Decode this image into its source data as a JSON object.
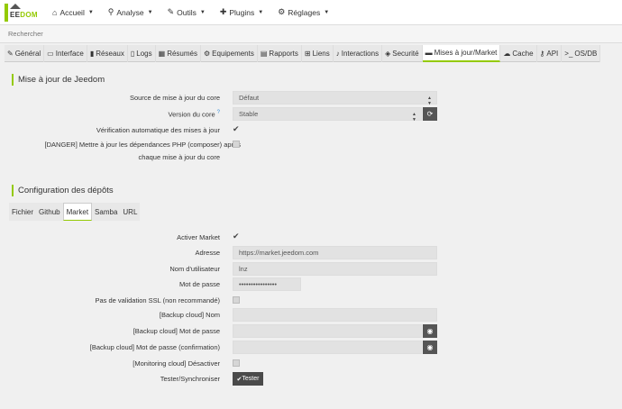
{
  "navbar": {
    "logo_text_a": "EE",
    "logo_text_b": "DOM",
    "items": [
      {
        "label": "Accueil",
        "icon": "home-icon"
      },
      {
        "label": "Analyse",
        "icon": "analysis-icon"
      },
      {
        "label": "Outils",
        "icon": "wrench-icon"
      },
      {
        "label": "Plugins",
        "icon": "puzzle-icon"
      },
      {
        "label": "Réglages",
        "icon": "gear-icon"
      }
    ]
  },
  "search": {
    "placeholder": "Rechercher"
  },
  "tabs": [
    {
      "label": "Général",
      "icon": "wrench-icon"
    },
    {
      "label": "Interface",
      "icon": "laptop-icon"
    },
    {
      "label": "Réseaux",
      "icon": "signal-icon"
    },
    {
      "label": "Logs",
      "icon": "file-icon"
    },
    {
      "label": "Résumés",
      "icon": "table-icon"
    },
    {
      "label": "Equipements",
      "icon": "cog-icon"
    },
    {
      "label": "Rapports",
      "icon": "print-icon"
    },
    {
      "label": "Liens",
      "icon": "sitemap-icon"
    },
    {
      "label": "Interactions",
      "icon": "mic-icon"
    },
    {
      "label": "Securité",
      "icon": "shield-icon"
    },
    {
      "label": "Mises à jour/Market",
      "icon": "credit-card-icon"
    },
    {
      "label": "Cache",
      "icon": "cloud-icon"
    },
    {
      "label": "API",
      "icon": "key-icon"
    },
    {
      "label": "OS/DB",
      "icon": "terminal-icon"
    }
  ],
  "update": {
    "title": "Mise à jour de Jeedom",
    "source_label": "Source de mise à jour du core",
    "source_value": "Défaut",
    "version_label": "Version du core",
    "version_value": "Stable",
    "auto_check_label": "Vérification automatique des mises à jour",
    "danger_label_1": "[DANGER] Mettre à jour les dépendances PHP (composer) après",
    "danger_label_2": "chaque mise à jour du core"
  },
  "depots": {
    "title": "Configuration des dépôts",
    "subtabs": [
      "Fichier",
      "Github",
      "Market",
      "Samba",
      "URL"
    ],
    "activate_label": "Activer Market",
    "address_label": "Adresse",
    "address_value": "https://market.jeedom.com",
    "username_label": "Nom d'utilisateur",
    "username_value": "lnz",
    "password_label": "Mot de passe",
    "password_value": "••••••••••••••••",
    "ssl_label": "Pas de validation SSL (non recommandé)",
    "backup_name_label": "[Backup cloud] Nom",
    "backup_pass_label": "[Backup cloud] Mot de passe",
    "backup_pass_confirm_label": "[Backup cloud] Mot de passe (confirmation)",
    "monitoring_label": "[Monitoring cloud] Désactiver",
    "test_label": "Tester/Synchroniser",
    "test_button": "Tester"
  }
}
